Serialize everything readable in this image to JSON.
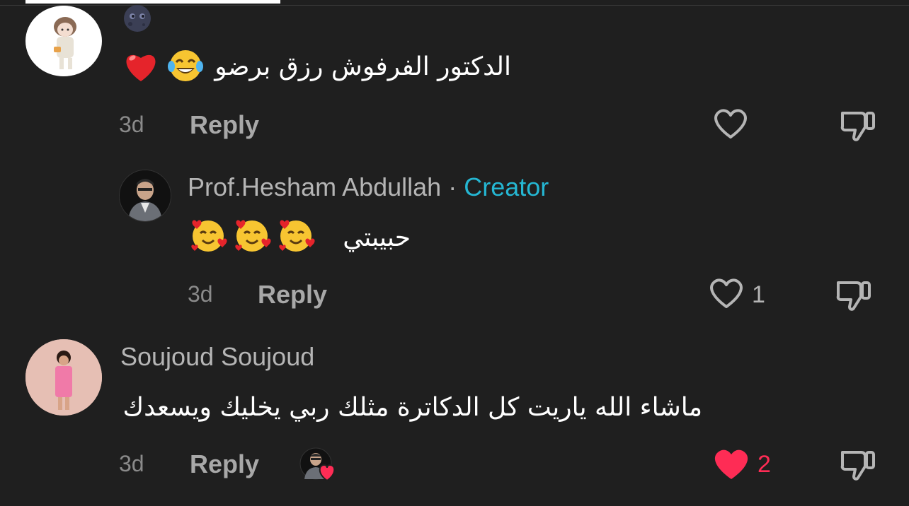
{
  "comments": [
    {
      "username": "",
      "text": "الدكتور الفرفوش رزق برضو",
      "time": "3d",
      "reply_label": "Reply",
      "like_count": "",
      "liked": false
    },
    {
      "username": "Prof.Hesham Abdullah",
      "separator": "·",
      "badge": "Creator",
      "text": "حبيبتي",
      "time": "3d",
      "reply_label": "Reply",
      "like_count": "1",
      "liked": false
    },
    {
      "username": "Soujoud Soujoud",
      "text": "ماشاء الله ياريت كل الدكاترة مثلك ربي يخليك ويسعدك",
      "time": "3d",
      "reply_label": "Reply",
      "like_count": "2",
      "liked": true
    }
  ],
  "icons": {
    "like": "heart-outline-icon",
    "liked": "heart-filled-icon",
    "dislike": "thumbs-down-icon",
    "creator_liked": "creator-liked-icon"
  },
  "colors": {
    "background": "#1f1f1f",
    "creator_badge": "#25b7d3",
    "like_active": "#fe2c55",
    "muted_text": "#8a8a8a"
  }
}
